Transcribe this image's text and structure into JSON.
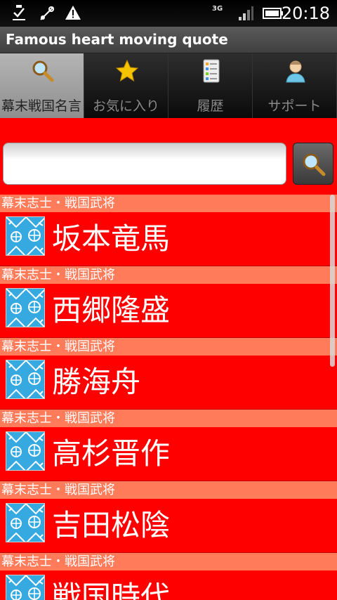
{
  "status_bar": {
    "time": "20:18",
    "network": "3G",
    "icons": [
      "download-done-icon",
      "usb-debug-icon",
      "warning-icon",
      "signal-icon",
      "battery-icon"
    ]
  },
  "app": {
    "title": "Famous heart moving quote"
  },
  "tabs": [
    {
      "label": "幕末戦国名言",
      "icon": "search-icon",
      "selected": true
    },
    {
      "label": "お気に入り",
      "icon": "star-icon",
      "selected": false
    },
    {
      "label": "履歴",
      "icon": "history-list-icon",
      "selected": false
    },
    {
      "label": "サポート",
      "icon": "person-icon",
      "selected": false
    }
  ],
  "search": {
    "value": "",
    "placeholder": "",
    "button_icon": "search-icon"
  },
  "list": [
    {
      "category": "幕末志士・戦国武将",
      "name": "坂本竜馬"
    },
    {
      "category": "幕末志士・戦国武将",
      "name": "西郷隆盛"
    },
    {
      "category": "幕末志士・戦国武将",
      "name": "勝海舟"
    },
    {
      "category": "幕末志士・戦国武将",
      "name": "高杉晋作"
    },
    {
      "category": "幕末志士・戦国武将",
      "name": "吉田松陰"
    },
    {
      "category": "幕末志士・戦国武将",
      "name": "戦国時代"
    }
  ],
  "colors": {
    "background": "#ff0000",
    "category_bar": "#ff7b5a",
    "thumb": "#36a9e1"
  }
}
